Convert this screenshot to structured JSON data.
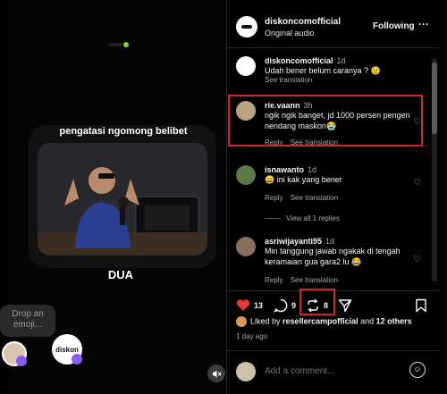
{
  "video": {
    "caption": "pengatasi ngomong belibet",
    "bottom_text": "DUA",
    "drop_emoji": "Drop an emoji...",
    "sticker_brand": "diskon"
  },
  "header": {
    "username": "diskoncomofficial",
    "audio": "Original audio",
    "following": "Following",
    "more": "···"
  },
  "comments": [
    {
      "user": "diskoncomofficial",
      "time": "1d",
      "text": "Udah bener belum caranya ? 😟",
      "actions": [
        "See translation"
      ],
      "avatar_color": "#ffffff"
    },
    {
      "user": "rie.vaann",
      "time": "3h",
      "text": "ngik ngik banget, jd 1000 persen pengen nendang maskon😭",
      "actions": [
        "Reply",
        "See translation"
      ],
      "avatar_color": "#b9a27f"
    },
    {
      "user": "isnawanto",
      "time": "1d",
      "text": "😀 ini kak yang bener",
      "actions": [
        "Reply",
        "See translation"
      ],
      "avatar_color": "#5a7a4a"
    },
    {
      "user": "asriwijayanti95",
      "time": "1d",
      "text": "Min tanggung jawab ngakak di tengah keramaian gua gara2 lu 😂",
      "actions": [
        "Reply",
        "See translation"
      ],
      "avatar_color": "#8a6f5f"
    }
  ],
  "view_replies": "View all 1 replies",
  "stats": {
    "likes": "13",
    "comments": "9",
    "reposts": "8"
  },
  "liked_by": {
    "prefix": "Liked by",
    "user": "resellercampofficial",
    "and": "and",
    "others": "12 others"
  },
  "post_age": "1 day ago",
  "add_comment": {
    "placeholder": "Add a comment..."
  },
  "colors": {
    "highlight": "#d32626",
    "like": "#e53935"
  }
}
